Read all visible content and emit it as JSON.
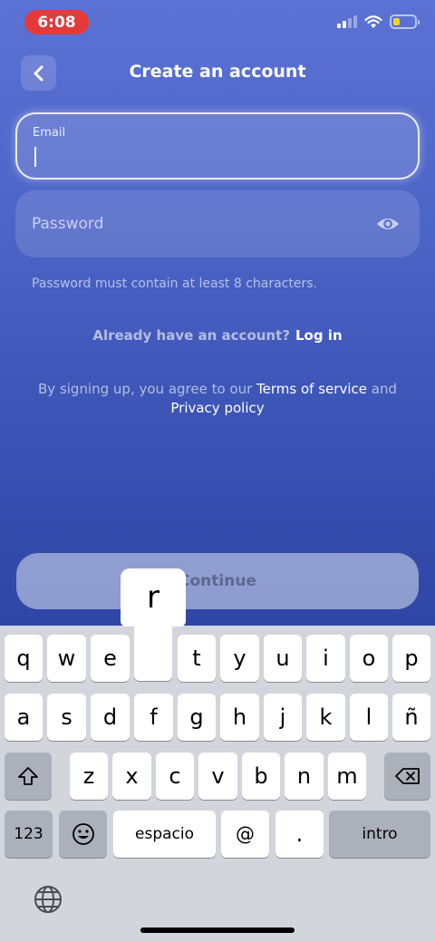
{
  "status_bar": {
    "time": "6:08"
  },
  "header": {
    "title": "Create an account"
  },
  "form": {
    "email_label": "Email",
    "password_placeholder": "Password",
    "password_hint": "Password must contain at least 8 characters."
  },
  "login": {
    "question": "Already have an account?",
    "link": "Log in"
  },
  "terms": {
    "prefix": "By signing up, you agree to our",
    "terms_link": "Terms of service",
    "and": "and",
    "privacy_link": "Privacy policy"
  },
  "continue_label": "Continue",
  "keyboard": {
    "popup_key": "r",
    "row1": [
      "q",
      "w",
      "e",
      "r",
      "t",
      "y",
      "u",
      "i",
      "o",
      "p"
    ],
    "row2": [
      "a",
      "s",
      "d",
      "f",
      "g",
      "h",
      "j",
      "k",
      "l",
      "ñ"
    ],
    "row3": [
      "z",
      "x",
      "c",
      "v",
      "b",
      "n",
      "m"
    ],
    "numbers_label": "123",
    "space_label": "espacio",
    "at_label": "@",
    "dot_label": ".",
    "return_label": "intro"
  },
  "colors": {
    "time_pill": "#e5393a",
    "battery": "#f5d12c"
  },
  "icons": [
    "back-chevron-icon",
    "eye-icon",
    "shift-icon",
    "delete-icon",
    "emoji-icon",
    "globe-icon"
  ]
}
